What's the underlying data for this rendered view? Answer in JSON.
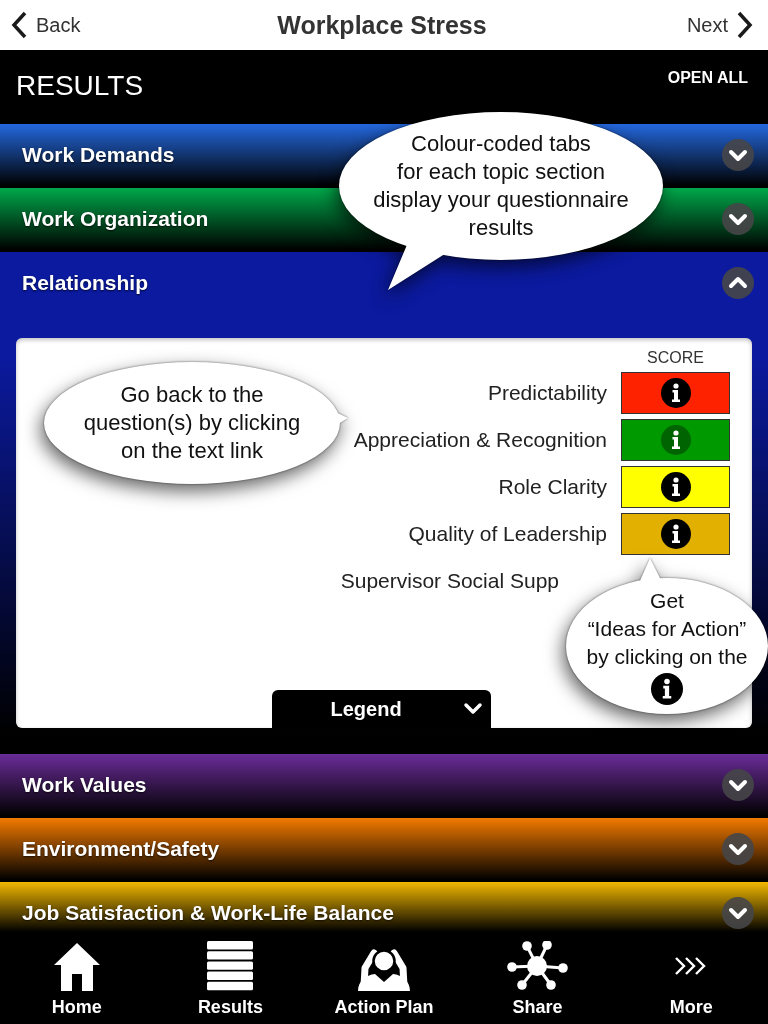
{
  "nav": {
    "back": "Back",
    "title": "Workplace Stress",
    "next": "Next"
  },
  "results_bar": {
    "title": "RESULTS",
    "open_all": "OPEN ALL"
  },
  "sections": [
    {
      "title": "Work Demands",
      "color": "#2468de",
      "expanded": false
    },
    {
      "title": "Work Organization",
      "color": "#00a84a",
      "expanded": false
    },
    {
      "title": "Relationship",
      "color": "#0b1a9e",
      "expanded": true,
      "score_heading": "SCORE",
      "rows": [
        {
          "label": "Predictability",
          "color": "#ff2200",
          "info_enabled": true
        },
        {
          "label": "Appreciation & Recognition",
          "color": "#009a00",
          "info_enabled": false
        },
        {
          "label": "Role Clarity",
          "color": "#ffff00",
          "info_enabled": true
        },
        {
          "label": "Quality of Leadership",
          "color": "#e2b000",
          "info_enabled": true
        },
        {
          "label": "Supervisor Social Supp"
        }
      ],
      "legend": "Legend"
    },
    {
      "title": "Work Values",
      "color": "#6a2c98",
      "expanded": false
    },
    {
      "title": "Environment/Safety",
      "color": "#f27a00",
      "expanded": false
    },
    {
      "title": "Job Satisfaction & Work-Life Balance",
      "color": "#f2b800",
      "expanded": false
    }
  ],
  "callouts": [
    {
      "kind": "text",
      "text": "Colour-coded tabs\nfor each topic section\ndisplay your questionnaire\nresults"
    },
    {
      "kind": "text",
      "text": "Go back to the\nquestion(s) by clicking\non the text link"
    },
    {
      "kind": "text-icon",
      "text": "Get\n“Ideas for Action”\nby clicking on the"
    }
  ],
  "tab_bar": [
    {
      "label": "Home",
      "selected": false
    },
    {
      "label": "Results",
      "selected": false
    },
    {
      "label": "Action Plan",
      "selected": false
    },
    {
      "label": "Share",
      "selected": false
    },
    {
      "label": "More",
      "selected": false
    }
  ]
}
